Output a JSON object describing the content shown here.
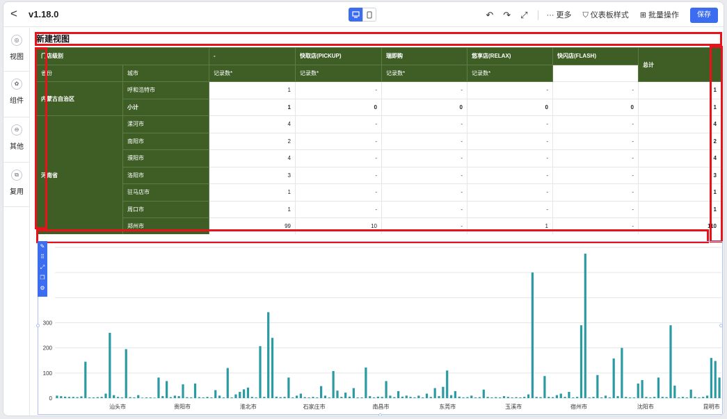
{
  "topbar": {
    "version": "v1.18.0",
    "more": "更多",
    "dashboard_style": "仪表板样式",
    "batch": "批量操作",
    "save": "保存"
  },
  "leftnav": [
    {
      "label": "视图",
      "icon": "view-icon"
    },
    {
      "label": "组件",
      "icon": "component-icon"
    },
    {
      "label": "其他",
      "icon": "other-icon"
    },
    {
      "label": "复用",
      "icon": "reuse-icon"
    }
  ],
  "view": {
    "title": "新建视图"
  },
  "table": {
    "header1": [
      "门店级别",
      "-",
      "快取店(PICKUP)",
      "瑞即购",
      "悠享店(RELAX)",
      "快闪店(FLASH)",
      "总计"
    ],
    "header2": [
      "省份",
      "城市",
      "记录数*",
      "记录数*",
      "记录数*",
      "记录数*",
      "记录数*"
    ],
    "rows": [
      {
        "province": "内蒙古自治区",
        "city": "呼和浩特市",
        "vals": [
          "1",
          "-",
          "-",
          "-",
          "-",
          "1"
        ],
        "bold": false
      },
      {
        "province": "",
        "city": "小计",
        "vals": [
          "1",
          "0",
          "0",
          "0",
          "0",
          "1"
        ],
        "bold": true
      },
      {
        "province": "河南省",
        "city": "漯河市",
        "vals": [
          "4",
          "-",
          "-",
          "-",
          "-",
          "4"
        ],
        "bold": false
      },
      {
        "province": "",
        "city": "南阳市",
        "vals": [
          "2",
          "-",
          "-",
          "-",
          "-",
          "2"
        ],
        "bold": false
      },
      {
        "province": "",
        "city": "濮阳市",
        "vals": [
          "4",
          "-",
          "-",
          "-",
          "-",
          "4"
        ],
        "bold": false
      },
      {
        "province": "",
        "city": "洛阳市",
        "vals": [
          "3",
          "-",
          "-",
          "-",
          "-",
          "3"
        ],
        "bold": false
      },
      {
        "province": "",
        "city": "驻马店市",
        "vals": [
          "1",
          "-",
          "-",
          "-",
          "-",
          "1"
        ],
        "bold": false
      },
      {
        "province": "",
        "city": "周口市",
        "vals": [
          "1",
          "-",
          "-",
          "-",
          "-",
          "1"
        ],
        "bold": false
      },
      {
        "province": "",
        "city": "郑州市",
        "vals": [
          "99",
          "10",
          "-",
          "1",
          "-",
          "110"
        ],
        "bold": false
      }
    ]
  },
  "chart_data": {
    "type": "bar",
    "color": "#2a9ba3",
    "ylim": [
      0,
      600
    ],
    "yticks": [
      "0",
      "100",
      "200",
      "300",
      "",
      "",
      ""
    ],
    "xlabels": [
      "汕头市",
      "贵阳市",
      "淮北市",
      "石家庄市",
      "南昌市",
      "东莞市",
      "玉溪市",
      "宿州市",
      "沈阳市",
      "昆明市"
    ],
    "values": [
      10,
      8,
      6,
      5,
      5,
      4,
      7,
      145,
      3,
      3,
      4,
      5,
      18,
      260,
      12,
      5,
      3,
      195,
      4,
      3,
      12,
      2,
      3,
      3,
      2,
      82,
      8,
      68,
      4,
      10,
      8,
      55,
      4,
      3,
      58,
      4,
      3,
      5,
      3,
      32,
      10,
      3,
      120,
      3,
      15,
      25,
      35,
      42,
      5,
      3,
      207,
      5,
      342,
      240,
      6,
      4,
      5,
      82,
      3,
      10,
      18,
      4,
      3,
      5,
      3,
      48,
      10,
      3,
      108,
      30,
      5,
      22,
      6,
      40,
      3,
      3,
      122,
      8,
      3,
      6,
      5,
      68,
      10,
      4,
      28,
      6,
      10,
      5,
      3,
      10,
      3,
      18,
      5,
      40,
      8,
      45,
      110,
      12,
      28,
      6,
      3,
      4,
      10,
      3,
      4,
      34,
      5,
      3,
      4,
      3,
      8,
      5,
      3,
      4,
      3,
      5,
      15,
      500,
      5,
      4,
      88,
      5,
      4,
      12,
      18,
      5,
      25,
      3,
      5,
      290,
      575,
      3,
      5,
      92,
      3,
      10,
      3,
      158,
      8,
      200,
      5,
      3,
      3,
      58,
      72,
      5,
      3,
      5,
      82,
      5,
      4,
      290,
      50,
      3,
      5,
      3,
      34,
      5,
      3,
      5,
      10,
      160,
      148,
      82
    ]
  }
}
